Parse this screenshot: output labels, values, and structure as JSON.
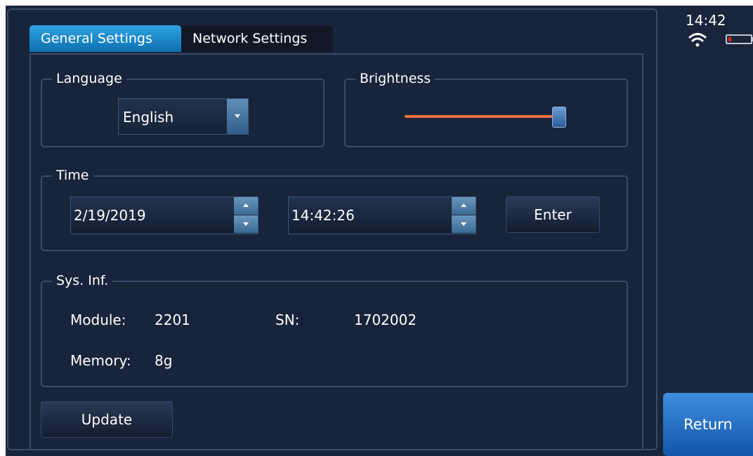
{
  "status": {
    "time": "14:42",
    "battery_level": 0.1,
    "wifi_icon": "wifi-icon"
  },
  "tabs": [
    {
      "label": "General Settings",
      "active": true
    },
    {
      "label": "Network Settings",
      "active": false
    }
  ],
  "language": {
    "title": "Language",
    "value": "English"
  },
  "brightness": {
    "title": "Brightness",
    "level": 1.0
  },
  "time_group": {
    "title": "Time",
    "date_value": "2/19/2019",
    "time_value": "14:42:26",
    "enter_label": "Enter"
  },
  "sys_info": {
    "title": "Sys. Inf.",
    "module_label": "Module:",
    "module_value": "2201",
    "sn_label": "SN:",
    "sn_value": "1702002",
    "memory_label": "Memory:",
    "memory_value": "8g"
  },
  "update_label": "Update",
  "return_label": "Return",
  "colors": {
    "accent": "#1e8fd6",
    "background": "#19253a",
    "slider": "#e8703e"
  }
}
